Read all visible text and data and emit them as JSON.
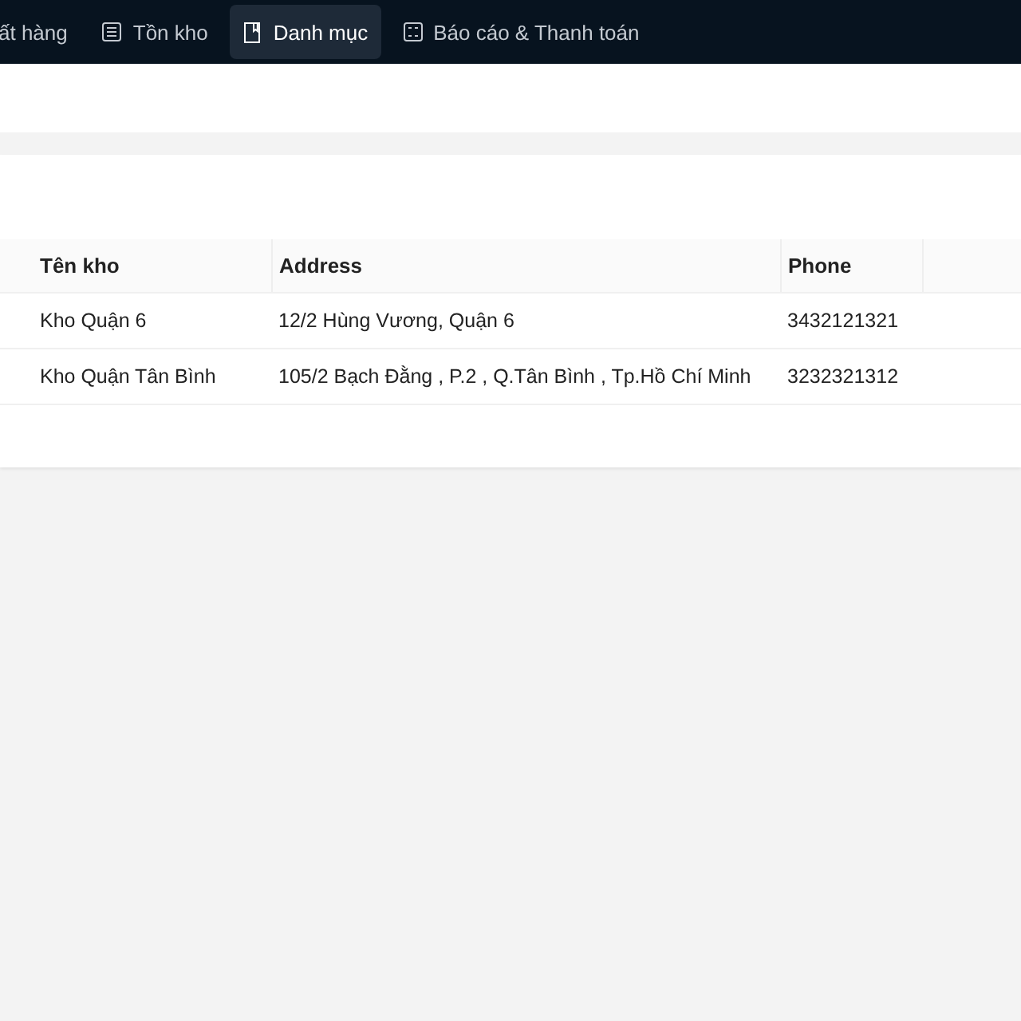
{
  "tabs": [
    {
      "label": "ất hàng",
      "kind": "plain",
      "selected": false
    },
    {
      "label": "Tồn kho",
      "kind": "list",
      "selected": false
    },
    {
      "label": "Danh mục",
      "kind": "book",
      "selected": true
    },
    {
      "label": "Báo cáo & Thanh toán",
      "kind": "grid",
      "selected": false
    }
  ],
  "table": {
    "columns": [
      "Tên kho",
      "Address",
      "Phone"
    ],
    "rows": [
      [
        "Kho Quận 6",
        "12/2 Hùng Vương, Quận 6",
        "3432121321"
      ],
      [
        "Kho Quận Tân Bình",
        "105/2 Bạch Đằng , P.2 , Q.Tân Bình , Tp.Hồ Chí Minh",
        "3232321312"
      ]
    ]
  }
}
